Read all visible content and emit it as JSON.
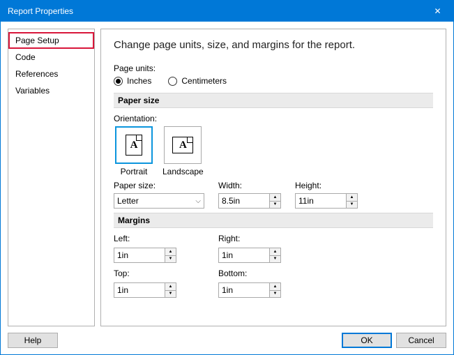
{
  "window": {
    "title": "Report Properties",
    "close": "✕"
  },
  "sidebar": {
    "items": [
      {
        "label": "Page Setup"
      },
      {
        "label": "Code"
      },
      {
        "label": "References"
      },
      {
        "label": "Variables"
      }
    ]
  },
  "main": {
    "heading": "Change page units, size, and margins for the report.",
    "page_units_label": "Page units:",
    "radio_inches": "Inches",
    "radio_centimeters": "Centimeters",
    "paper_size_header": "Paper size",
    "orientation_label": "Orientation:",
    "portrait": "Portrait",
    "landscape": "Landscape",
    "paper_size_label": "Paper size:",
    "paper_size_value": "Letter",
    "width_label": "Width:",
    "width_value": "8.5in",
    "height_label": "Height:",
    "height_value": "11in",
    "margins_header": "Margins",
    "left_label": "Left:",
    "left_value": "1in",
    "right_label": "Right:",
    "right_value": "1in",
    "top_label": "Top:",
    "top_value": "1in",
    "bottom_label": "Bottom:",
    "bottom_value": "1in"
  },
  "footer": {
    "help": "Help",
    "ok": "OK",
    "cancel": "Cancel"
  },
  "glyph": {
    "a": "A",
    "up": "▲",
    "down": "▼",
    "chev": "⌵"
  }
}
